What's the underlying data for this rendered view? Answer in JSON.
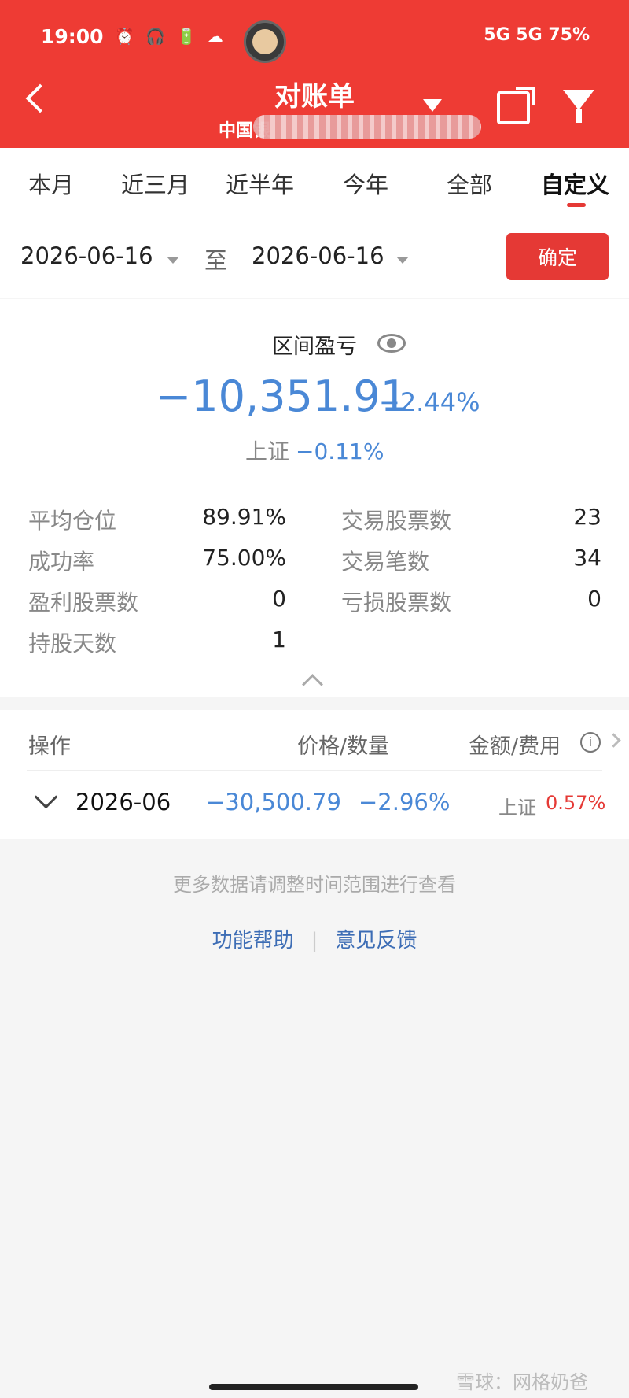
{
  "status_bar": {
    "time": "19:00",
    "left_icons": "⏰ 🎧 🔋 ☁",
    "battery": "75%",
    "right_icons": "5G 5G"
  },
  "header": {
    "title": "对账单",
    "subtitle": "中国银"
  },
  "tabs": [
    "本月",
    "近三月",
    "近半年",
    "今年",
    "全部",
    "自定义"
  ],
  "active_tab": 5,
  "date_range": {
    "start": "2026-06-16",
    "to_label": "至",
    "end": "2026-06-16",
    "confirm_label": "确定"
  },
  "summary": {
    "label": "区间盈亏",
    "value": "−10,351.91",
    "percent": "−2.44%",
    "index_name": "上证",
    "index_percent": "−0.11%"
  },
  "stats": {
    "avg_position_label": "平均仓位",
    "avg_position": "89.91%",
    "traded_stocks_label": "交易股票数",
    "traded_stocks": "23",
    "success_rate_label": "成功率",
    "success_rate": "75.00%",
    "trade_count_label": "交易笔数",
    "trade_count": "34",
    "profit_stocks_label": "盈利股票数",
    "profit_stocks": "0",
    "loss_stocks_label": "亏损股票数",
    "loss_stocks": "0",
    "holding_days_label": "持股天数",
    "holding_days": "1"
  },
  "table": {
    "headers": [
      "操作",
      "价格/数量",
      "金额/费用"
    ],
    "rows": [
      {
        "month": "2026-06",
        "amount": "−30,500.79",
        "percent": "−2.96%",
        "index_name": "上证",
        "index_percent": "0.57%"
      }
    ]
  },
  "footer": {
    "note": "更多数据请调整时间范围进行查看",
    "help": "功能帮助",
    "feedback": "意见反馈"
  },
  "watermark": "雪球：网格奶爸",
  "colors": {
    "brand_red": "#ee3b34",
    "negative_blue": "#4a88d6",
    "positive_red": "#e53935"
  }
}
